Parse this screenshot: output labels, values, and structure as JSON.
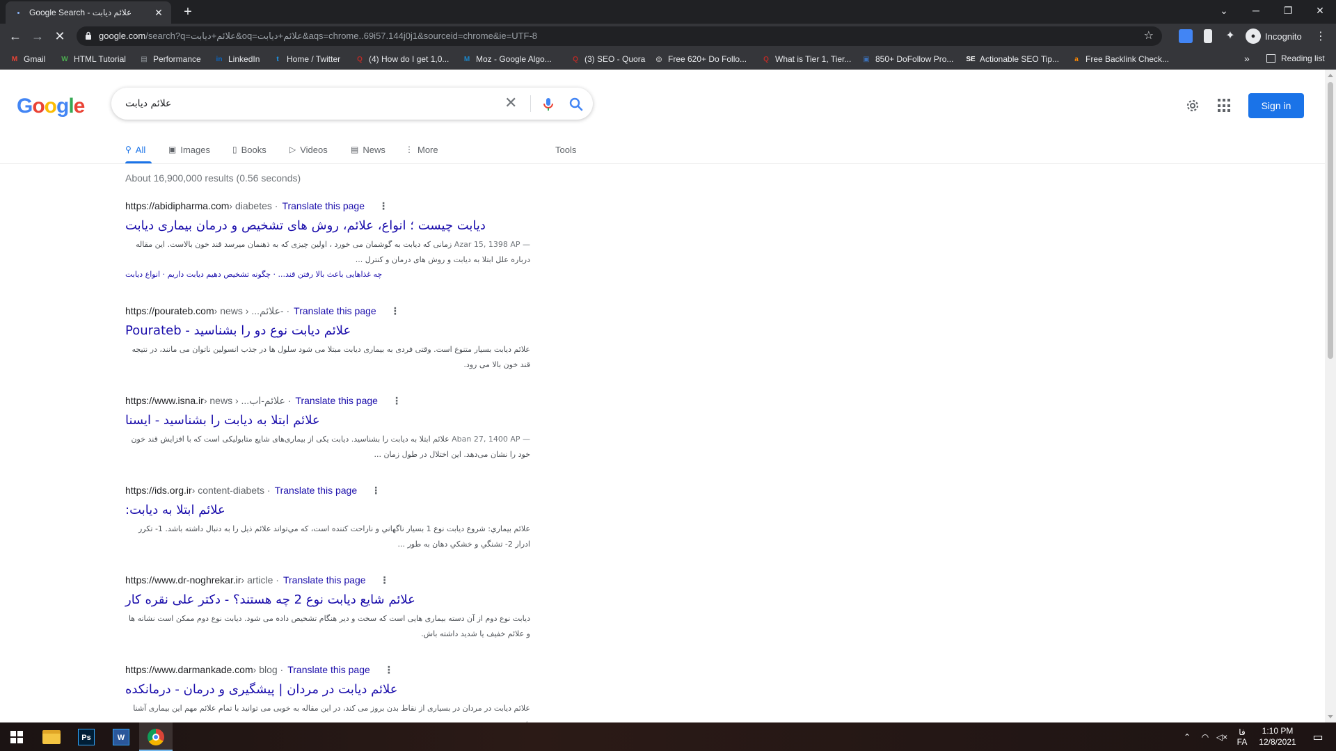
{
  "browser": {
    "tab_title": "Google Search - علائم دیابت",
    "url_host": "google.com",
    "url_rest": "/search?q=علائم+دیابت&oq=علائم+دیابت&aqs=chrome..69i57.144j0j1&sourceid=chrome&ie=UTF-8",
    "profile_label": "Incognito"
  },
  "bookmarks": [
    {
      "label": "Gmail",
      "icon": "gmail-icon",
      "color": "#ea4335",
      "glyph": "M"
    },
    {
      "label": "HTML Tutorial",
      "icon": "w3schools-icon",
      "color": "#4caf50",
      "glyph": "W"
    },
    {
      "label": "Performance",
      "icon": "performance-icon",
      "color": "#9aa0a6",
      "glyph": "▤"
    },
    {
      "label": "LinkedIn",
      "icon": "linkedin-icon",
      "color": "#0a66c2",
      "glyph": "in"
    },
    {
      "label": "Home / Twitter",
      "icon": "twitter-icon",
      "color": "#1d9bf0",
      "glyph": "t"
    },
    {
      "label": "(4) How do I get 1,0...",
      "icon": "quora-icon",
      "color": "#b92b27",
      "glyph": "Q"
    },
    {
      "label": "Moz - Google Algo...",
      "icon": "moz-icon",
      "color": "#1c86c8",
      "glyph": "M"
    },
    {
      "label": "(3) SEO - Quora",
      "icon": "quora-icon",
      "color": "#b92b27",
      "glyph": "Q"
    },
    {
      "label": "Free 620+ Do Follo...",
      "icon": "site-icon",
      "color": "#ffffff",
      "glyph": "◎"
    },
    {
      "label": "What is Tier 1, Tier...",
      "icon": "quora-icon",
      "color": "#b92b27",
      "glyph": "Q"
    },
    {
      "label": "850+ DoFollow Pro...",
      "icon": "site-icon",
      "color": "#3b6fb6",
      "glyph": "▣"
    },
    {
      "label": "Actionable SEO Tip...",
      "icon": "seo-icon",
      "color": "#ffffff",
      "glyph": "SE"
    },
    {
      "label": "Free Backlink Check...",
      "icon": "ahrefs-icon",
      "color": "#ff8800",
      "glyph": "a"
    }
  ],
  "reading_list_label": "Reading list",
  "google": {
    "logo": [
      "G",
      "o",
      "o",
      "g",
      "l",
      "e"
    ],
    "query": "علائم دیابت",
    "signin_label": "Sign in",
    "tabs": [
      {
        "label": "All",
        "icon": "search-icon",
        "glyph": "⚲"
      },
      {
        "label": "Images",
        "icon": "image-icon",
        "glyph": "▣"
      },
      {
        "label": "Books",
        "icon": "book-icon",
        "glyph": "▯"
      },
      {
        "label": "Videos",
        "icon": "video-icon",
        "glyph": "▷"
      },
      {
        "label": "News",
        "icon": "news-icon",
        "glyph": "▤"
      },
      {
        "label": "More",
        "icon": "more-icon",
        "glyph": "⋮"
      }
    ],
    "tools_label": "Tools",
    "stats": "About 16,900,000 results (0.56 seconds)"
  },
  "results": [
    {
      "site": "https://abidipharma.com",
      "path": " › diabetes",
      "translate": "Translate this page",
      "title": "دیابت چیست ؛ انواع، علائم، روش های تشخیص و درمان بیماری دیابت",
      "date": "Azar 15, 1398 AP —",
      "snippet": "زمانی که دیابت به گوشمان می خورد ، اولین چیزی که به ذهنمان میرسد قند خون بالاست. این مقاله درباره علل ابتلا به دیابت و روش های درمان و کنترل ...",
      "sublinks": "چه غذاهایی باعث بالا رفتن قند... · چگونه تشخیص دهیم دیابت داریم · انواع دیابت"
    },
    {
      "site": "https://pourateb.com",
      "path": " › news › ...علائم-",
      "translate": "Translate this page",
      "title": "علائم دیابت نوع دو را بشناسید - Pourateb",
      "date": "",
      "snippet": "علائم دیابت بسیار متنوع است. وقتی فردی به بیماری دیابت مبتلا می شود سلول ها در جذب انسولین ناتوان می مانند، در نتیجه قند خون بالا می رود.",
      "sublinks": ""
    },
    {
      "site": "https://www.isna.ir",
      "path": " › news › ...علائم-اب",
      "translate": "Translate this page",
      "title": "علائم ابتلا به دیابت را بشناسید - ایسنا",
      "date": "Aban 27, 1400 AP —",
      "snippet": "علائم ابتلا به دیابت را بشناسید. دیابت یکی از بیماری‌های شایع متابولیکی است که با افزایش قند خون خود را نشان می‌دهد. این اختلال در طول زمان ...",
      "sublinks": ""
    },
    {
      "site": "https://ids.org.ir",
      "path": " › content-diabets",
      "translate": "Translate this page",
      "title": "علائم ابتلا به دیابت:",
      "date": "",
      "snippet": "علائم بيماري: شروع دیابت نوع 1 بسيار ناگهاني و ناراحت كننده است، كه مي‌تواند علائم ذيل را به دنبال داشته باشد. 1- تكرر ادرار 2- تشنگي و خشكي دهان به طور ...",
      "sublinks": ""
    },
    {
      "site": "https://www.dr-noghrekar.ir",
      "path": " › article",
      "translate": "Translate this page",
      "title": "علائم شایع دیابت نوع 2 چه هستند؟ - دکتر علی نقره کار",
      "date": "",
      "snippet": "دیابت نوع دوم از آن دسته بیماری هایی است که سخت و دیر هنگام تشخیص داده می شود. دیابت نوع دوم ممکن است نشانه ها و علائم خفیف یا شدید داشته باش.",
      "sublinks": ""
    },
    {
      "site": "https://www.darmankade.com",
      "path": " › blog",
      "translate": "Translate this page",
      "title": "علائم دیابت در مردان | پیشگیری و درمان - درمانکده",
      "date": "",
      "snippet": "علائم دیابت در مردان در بسیاری از نقاط بدن بروز می کند، در این مقاله به خوبی می توانید با تمام علائم مهم این بیماری آشنا شوید",
      "sublinks": ""
    }
  ],
  "taskbar": {
    "apps": [
      {
        "name": "file-explorer-icon",
        "color": "#f4c542"
      },
      {
        "name": "photoshop-icon",
        "color": "#001e36",
        "glyph": "Ps"
      },
      {
        "name": "word-icon",
        "color": "#2b579a",
        "glyph": "W"
      },
      {
        "name": "chrome-icon",
        "color": "#db4437"
      }
    ],
    "language": "FA",
    "lang_script": "فا",
    "time": "1:10 PM",
    "date": "12/8/2021"
  }
}
